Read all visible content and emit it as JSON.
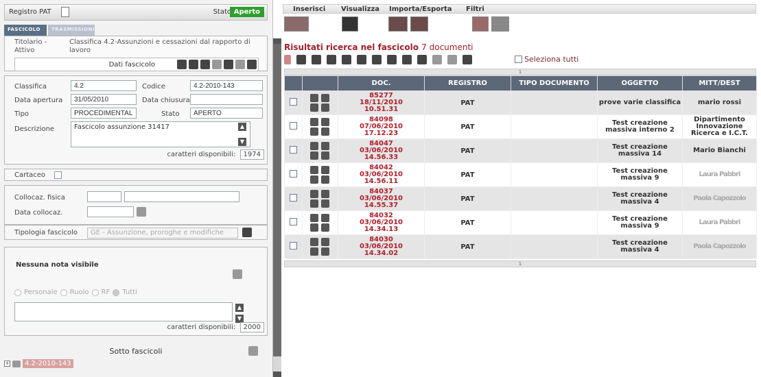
{
  "left": {
    "registro_label": "Registro PAT",
    "stato_label": "Stato",
    "stato_value": "Aperto",
    "tabs": [
      "FASCICOLO",
      "TRASMISSIONI"
    ],
    "title_key": "Titolario - Attivo",
    "title_value": "Classifica 4.2-Assunzioni e cessazioni dal rapporto di lavoro",
    "dati_fascicolo": "Dati fascicolo",
    "form": {
      "classifica_label": "Classifica",
      "classifica": "4.2",
      "codice_label": "Codice",
      "codice": "4.2-2010-143",
      "data_apertura_label": "Data apertura",
      "data_apertura": "31/05/2010",
      "data_chiusura_label": "Data chiusura",
      "data_chiusura": "",
      "tipo_label": "Tipo",
      "tipo": "PROCEDIMENTALE",
      "stato_label": "Stato",
      "stato": "APERTO",
      "descrizione_label": "Descrizione",
      "descrizione": "Fascicolo assunzione 31417",
      "caratteri_label": "caratteri disponibili:",
      "caratteri": "1974"
    },
    "cartaceo_label": "Cartaceo",
    "collocaz_fisica_label": "Collocaz. fisica",
    "data_collocaz_label": "Data collocaz.",
    "tipologia_label": "Tipologia fascicolo",
    "tipologia_value": "GE - Assunzione, proroghe e modifiche",
    "note_title": "Nessuna nota visibile",
    "radio_options": [
      "Personale",
      "Ruolo",
      "RF",
      "Tutti"
    ],
    "note_caratteri_label": "caratteri disponibili:",
    "note_caratteri": "2000",
    "sotto_fascicoli": "Sotto fascicoli",
    "tree_item": "4.2-2010-143"
  },
  "right": {
    "menus": [
      "Inserisci",
      "Visualizza",
      "Importa/Esporta",
      "Filtri"
    ],
    "result_title": "Risultati ricerca nel fascicolo",
    "result_count": "7 documenti",
    "select_all": "Seleziona tutti",
    "page_top": "1",
    "page_bottom": "1",
    "columns": [
      "",
      "",
      "DOC.",
      "REGISTRO",
      "TIPO DOCUMENTO",
      "OGGETTO",
      "MITT/DEST"
    ],
    "rows": [
      {
        "doc": "85277",
        "date": "18/11/2010",
        "time": "10.51.31",
        "registro": "PAT",
        "tipo": "",
        "oggetto": "prove varie classifica",
        "mitt": "mario rossi"
      },
      {
        "doc": "84098",
        "date": "07/06/2010",
        "time": "17.12.23",
        "registro": "PAT",
        "tipo": "",
        "oggetto": "Test creazione massiva interno 2",
        "mitt": "Dipartimento Innovazione Ricerca e I.C.T."
      },
      {
        "doc": "84047",
        "date": "03/06/2010",
        "time": "14.56.33",
        "registro": "PAT",
        "tipo": "",
        "oggetto": "Test creazione massiva 14",
        "mitt": "Mario Bianchi"
      },
      {
        "doc": "84042",
        "date": "03/06/2010",
        "time": "14.56.11",
        "registro": "PAT",
        "tipo": "",
        "oggetto": "Test creazione massiva 9",
        "mitt": "Laura Pabbri"
      },
      {
        "doc": "84037",
        "date": "03/06/2010",
        "time": "14.55.37",
        "registro": "PAT",
        "tipo": "",
        "oggetto": "Test creazione massiva 4",
        "mitt": "Paola Capozzolo"
      },
      {
        "doc": "84032",
        "date": "03/06/2010",
        "time": "14.34.13",
        "registro": "PAT",
        "tipo": "",
        "oggetto": "Test creazione massiva 9",
        "mitt": "Laura Pabbri"
      },
      {
        "doc": "84030",
        "date": "03/06/2010",
        "time": "14.34.02",
        "registro": "PAT",
        "tipo": "",
        "oggetto": "Test creazione massiva 4",
        "mitt": "Paola Capozzolo"
      }
    ]
  },
  "colors": {
    "accent_red": "#b0202a",
    "header_bg": "#5c6878",
    "stato_green": "#2e9e2e"
  }
}
